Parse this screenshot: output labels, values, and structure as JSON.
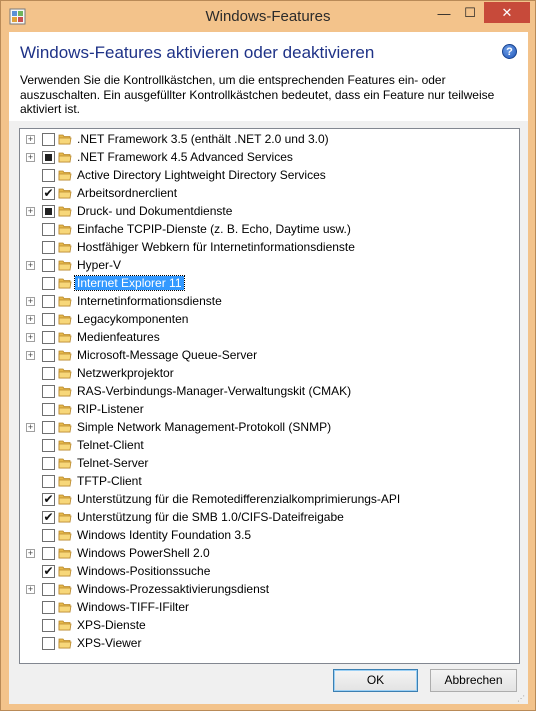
{
  "window": {
    "title": "Windows-Features",
    "minimize_glyph": "—",
    "maximize_glyph": "☐",
    "close_glyph": "✕"
  },
  "header": {
    "heading": "Windows-Features aktivieren oder deaktivieren",
    "help_glyph": "?",
    "description": "Verwenden Sie die Kontrollkästchen, um die entsprechenden Features ein- oder auszuschalten. Ein ausgefüllter Kontrollkästchen bedeutet, dass ein Feature nur teilweise aktiviert ist."
  },
  "features": [
    {
      "label": ".NET Framework 3.5 (enthält .NET 2.0 und 3.0)",
      "expandable": true,
      "state": "unchecked"
    },
    {
      "label": ".NET Framework 4.5 Advanced Services",
      "expandable": true,
      "state": "partial"
    },
    {
      "label": "Active Directory Lightweight Directory Services",
      "expandable": false,
      "state": "unchecked"
    },
    {
      "label": "Arbeitsordnerclient",
      "expandable": false,
      "state": "checked"
    },
    {
      "label": "Druck- und Dokumentdienste",
      "expandable": true,
      "state": "partial"
    },
    {
      "label": "Einfache TCPIP-Dienste (z. B. Echo, Daytime usw.)",
      "expandable": false,
      "state": "unchecked"
    },
    {
      "label": "Hostfähiger Webkern für Internetinformationsdienste",
      "expandable": false,
      "state": "unchecked"
    },
    {
      "label": "Hyper-V",
      "expandable": true,
      "state": "unchecked"
    },
    {
      "label": "Internet Explorer 11",
      "expandable": false,
      "state": "unchecked",
      "selected": true
    },
    {
      "label": "Internetinformationsdienste",
      "expandable": true,
      "state": "unchecked"
    },
    {
      "label": "Legacykomponenten",
      "expandable": true,
      "state": "unchecked"
    },
    {
      "label": "Medienfeatures",
      "expandable": true,
      "state": "unchecked"
    },
    {
      "label": "Microsoft-Message Queue-Server",
      "expandable": true,
      "state": "unchecked"
    },
    {
      "label": "Netzwerkprojektor",
      "expandable": false,
      "state": "unchecked"
    },
    {
      "label": "RAS-Verbindungs-Manager-Verwaltungskit (CMAK)",
      "expandable": false,
      "state": "unchecked"
    },
    {
      "label": "RIP-Listener",
      "expandable": false,
      "state": "unchecked"
    },
    {
      "label": "Simple Network Management-Protokoll (SNMP)",
      "expandable": true,
      "state": "unchecked"
    },
    {
      "label": "Telnet-Client",
      "expandable": false,
      "state": "unchecked"
    },
    {
      "label": "Telnet-Server",
      "expandable": false,
      "state": "unchecked"
    },
    {
      "label": "TFTP-Client",
      "expandable": false,
      "state": "unchecked"
    },
    {
      "label": "Unterstützung für die Remotedifferenzialkomprimierungs-API",
      "expandable": false,
      "state": "checked"
    },
    {
      "label": "Unterstützung für die SMB 1.0/CIFS-Dateifreigabe",
      "expandable": false,
      "state": "checked"
    },
    {
      "label": "Windows Identity Foundation 3.5",
      "expandable": false,
      "state": "unchecked"
    },
    {
      "label": "Windows PowerShell 2.0",
      "expandable": true,
      "state": "unchecked"
    },
    {
      "label": "Windows-Positionssuche",
      "expandable": false,
      "state": "checked"
    },
    {
      "label": "Windows-Prozessaktivierungsdienst",
      "expandable": true,
      "state": "unchecked"
    },
    {
      "label": "Windows-TIFF-IFilter",
      "expandable": false,
      "state": "unchecked"
    },
    {
      "label": "XPS-Dienste",
      "expandable": false,
      "state": "unchecked"
    },
    {
      "label": "XPS-Viewer",
      "expandable": false,
      "state": "unchecked"
    }
  ],
  "buttons": {
    "ok": "OK",
    "cancel": "Abbrechen"
  },
  "icons": {
    "expander": "plus-square-icon",
    "folder": "folder-icon",
    "check": "✔"
  },
  "colors": {
    "frame": "#f3c38b",
    "heading": "#1e3287",
    "selection": "#3399ff"
  }
}
